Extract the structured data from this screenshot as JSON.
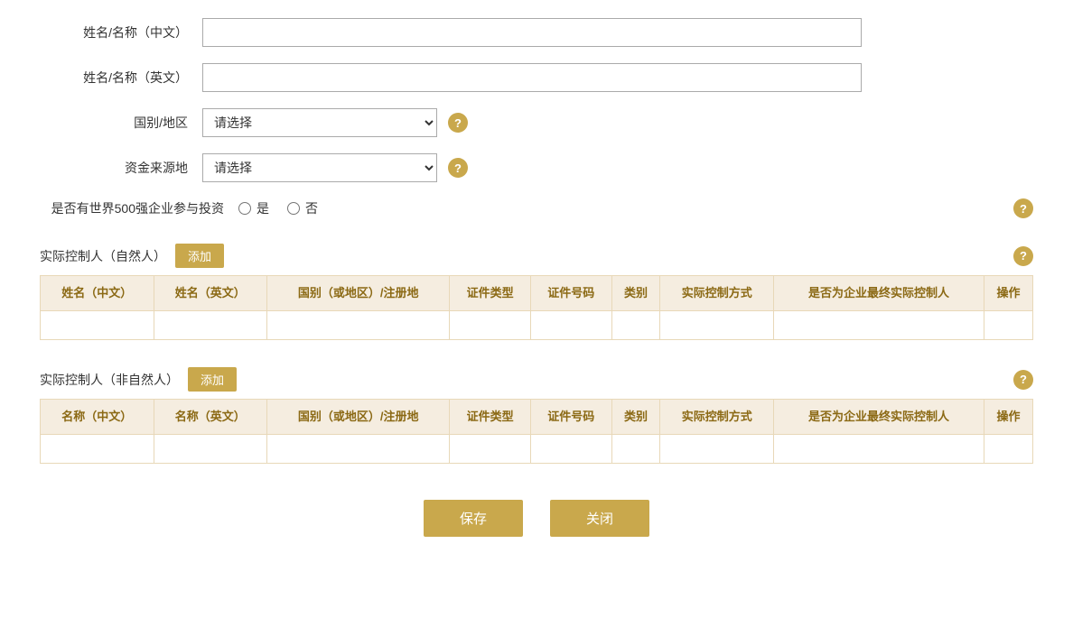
{
  "form": {
    "name_cn_label": "姓名/名称（中文）",
    "name_en_label": "姓名/名称（英文）",
    "country_label": "国别/地区",
    "fund_source_label": "资金来源地",
    "fortune500_label": "是否有世界500强企业参与投资",
    "fortune500_yes": "是",
    "fortune500_no": "否",
    "select_placeholder": "请选择"
  },
  "natural_person_section": {
    "title": "实际控制人（自然人）",
    "add_label": "添加",
    "columns": [
      "姓名（中文）",
      "姓名（英文）",
      "国别（或地区）/注册地",
      "证件类型",
      "证件号码",
      "类别",
      "实际控制方式",
      "是否为企业最终实际控制人",
      "操作"
    ]
  },
  "non_natural_person_section": {
    "title": "实际控制人（非自然人）",
    "add_label": "添加",
    "columns": [
      "名称（中文）",
      "名称（英文）",
      "国别（或地区）/注册地",
      "证件类型",
      "证件号码",
      "类别",
      "实际控制方式",
      "是否为企业最终实际控制人",
      "操作"
    ]
  },
  "buttons": {
    "save": "保存",
    "close": "关闭"
  },
  "icons": {
    "help": "?",
    "chevron": "▼"
  },
  "colors": {
    "gold": "#c9a84c",
    "table_header_bg": "#f5ede0",
    "table_header_text": "#8b6914"
  }
}
